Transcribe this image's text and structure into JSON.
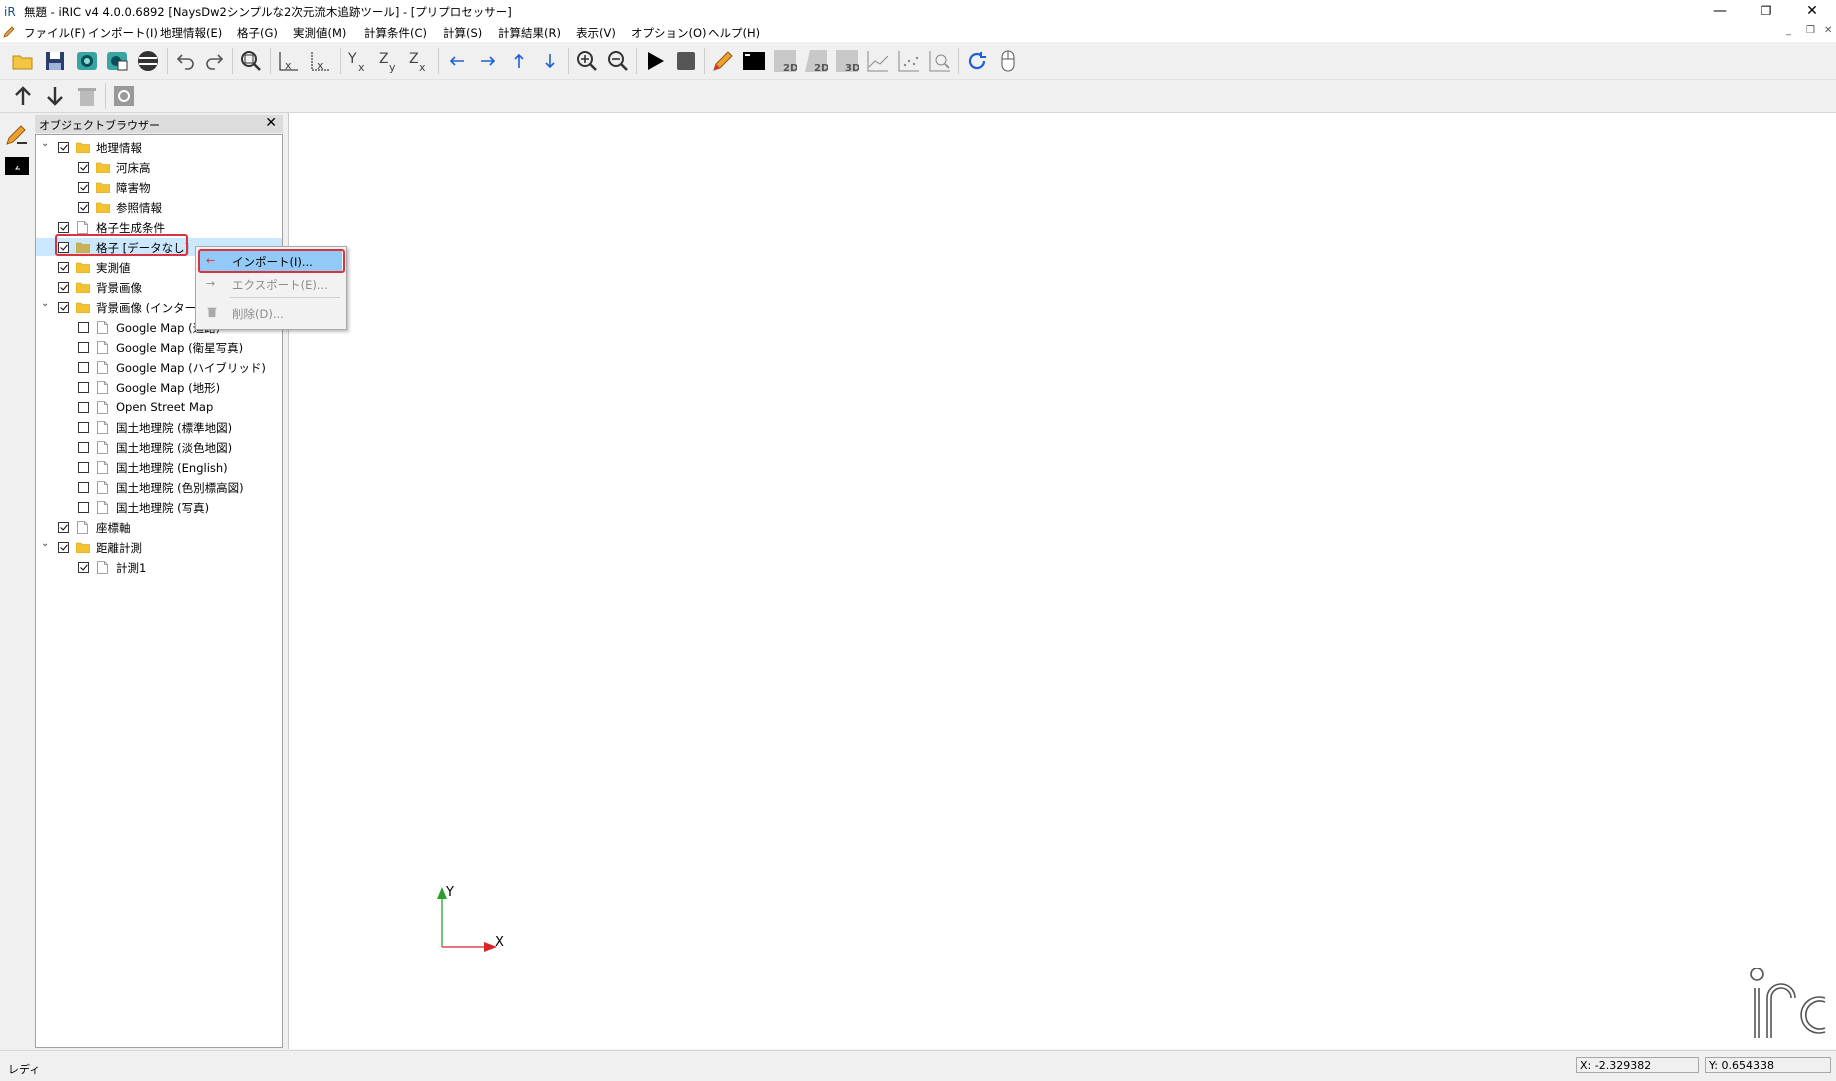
{
  "window": {
    "title": "無題 - iRIC v4 4.0.0.6892 [NaysDw2シンプルな2次元流木追跡ツール] - [プリプロセッサー]",
    "minimize": "—",
    "restore": "❐",
    "close": "✕"
  },
  "menubar": {
    "items": [
      "ファイル(F)",
      "インポート(I)",
      "地理情報(E)",
      "格子(G)",
      "実測値(M)",
      "計算条件(C)",
      "計算(S)",
      "計算結果(R)",
      "表示(V)",
      "オプション(O)",
      "ヘルプ(H)"
    ]
  },
  "object_browser": {
    "title": "オブジェクトブラウザー",
    "close": "✕",
    "tree": [
      {
        "label": "地理情報",
        "checked": true,
        "icon": "folder-icon",
        "expanded": true,
        "level": 0
      },
      {
        "label": "河床高",
        "checked": true,
        "icon": "folder-icon",
        "level": 1
      },
      {
        "label": "障害物",
        "checked": true,
        "icon": "folder-icon",
        "level": 1
      },
      {
        "label": "参照情報",
        "checked": true,
        "icon": "folder-icon",
        "level": 1
      },
      {
        "label": "格子生成条件",
        "checked": true,
        "icon": "doc-icon",
        "level": 0
      },
      {
        "label": "格子 [データなし]",
        "checked": true,
        "icon": "folder-icon",
        "level": 0,
        "selected": true
      },
      {
        "label": "実測値",
        "checked": true,
        "icon": "folder-icon",
        "level": 0
      },
      {
        "label": "背景画像",
        "checked": true,
        "icon": "folder-icon",
        "level": 0
      },
      {
        "label": "背景画像 (インター",
        "checked": true,
        "icon": "folder-icon",
        "expanded": true,
        "level": 0
      },
      {
        "label": "Google Map (道路)",
        "checked": false,
        "icon": "doc-icon",
        "level": 1
      },
      {
        "label": "Google Map (衛星写真)",
        "checked": false,
        "icon": "doc-icon",
        "level": 1
      },
      {
        "label": "Google Map (ハイブリッド)",
        "checked": false,
        "icon": "doc-icon",
        "level": 1
      },
      {
        "label": "Google Map (地形)",
        "checked": false,
        "icon": "doc-icon",
        "level": 1
      },
      {
        "label": "Open Street Map",
        "checked": false,
        "icon": "doc-icon",
        "level": 1
      },
      {
        "label": "国土地理院 (標準地図)",
        "checked": false,
        "icon": "doc-icon",
        "level": 1
      },
      {
        "label": "国土地理院 (淡色地図)",
        "checked": false,
        "icon": "doc-icon",
        "level": 1
      },
      {
        "label": "国土地理院 (English)",
        "checked": false,
        "icon": "doc-icon",
        "level": 1
      },
      {
        "label": "国土地理院 (色別標高図)",
        "checked": false,
        "icon": "doc-icon",
        "level": 1
      },
      {
        "label": "国土地理院 (写真)",
        "checked": false,
        "icon": "doc-icon",
        "level": 1
      },
      {
        "label": "座標軸",
        "checked": true,
        "icon": "doc-icon",
        "level": 0
      },
      {
        "label": "距離計測",
        "checked": true,
        "icon": "folder-icon",
        "expanded": true,
        "level": 0
      },
      {
        "label": "計測1",
        "checked": true,
        "icon": "doc-icon",
        "level": 1
      }
    ]
  },
  "context_menu": {
    "items": [
      {
        "label": "インポート(I)...",
        "enabled": true,
        "highlighted": true,
        "icon": "import-arrow-icon"
      },
      {
        "label": "エクスポート(E)...",
        "enabled": false,
        "icon": "export-arrow-icon"
      },
      {
        "label": "削除(D)...",
        "enabled": false,
        "icon": "trash-icon"
      }
    ]
  },
  "axes": {
    "y_label": "Y",
    "x_label": "X"
  },
  "statusbar": {
    "status": "レディ",
    "x_coord": "X: -2.329382",
    "y_coord": "Y: 0.654338"
  },
  "colors": {
    "highlight_red": "#d9333f",
    "selection_blue": "#cce8ff",
    "menu_highlight": "#91c9f7",
    "axis_y": "#2ca02c",
    "axis_x": "#d62728",
    "play": "#000000"
  }
}
